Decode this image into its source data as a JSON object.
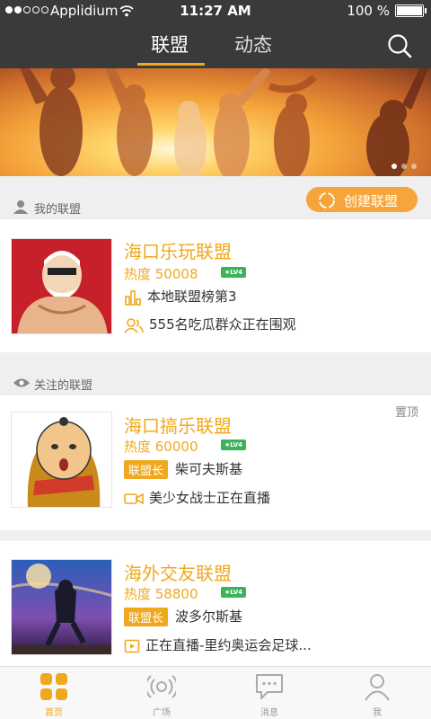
{
  "status_bar": {
    "carrier": "Applidium",
    "time": "11:27 AM",
    "battery": "100 %"
  },
  "nav": {
    "tabs": [
      "联盟",
      "动态"
    ],
    "active_tab": 0
  },
  "banner": {
    "pages": 3,
    "active_page": 0
  },
  "my_alliance": {
    "section_label": "我的联盟",
    "create_button": "创建联盟",
    "card": {
      "name": "海口乐玩联盟",
      "heat": "热度 50008",
      "level": "LV4",
      "rank": "本地联盟榜第3",
      "watchers": "555名吃瓜群众正在围观"
    }
  },
  "followed": {
    "section_label": "关注的联盟",
    "cards": [
      {
        "name": "海口搞乐联盟",
        "heat": "热度 60000",
        "level": "LV4",
        "leader_badge": "联盟长",
        "leader": "柴可夫斯基",
        "live": "美少女战士正在直播",
        "pin": "置顶"
      },
      {
        "name": "海外交友联盟",
        "heat": "热度 58800",
        "level": "LV4",
        "leader_badge": "联盟长",
        "leader": "波多尔斯基",
        "live": "正在直播-里约奥运会足球..."
      }
    ]
  },
  "tabbar": {
    "items": [
      "首页",
      "广场",
      "消息",
      "我"
    ],
    "active": 0
  },
  "colors": {
    "accent": "#f0a81e",
    "nav_bg": "#3a3a3a",
    "level_badge": "#3cb35a"
  }
}
